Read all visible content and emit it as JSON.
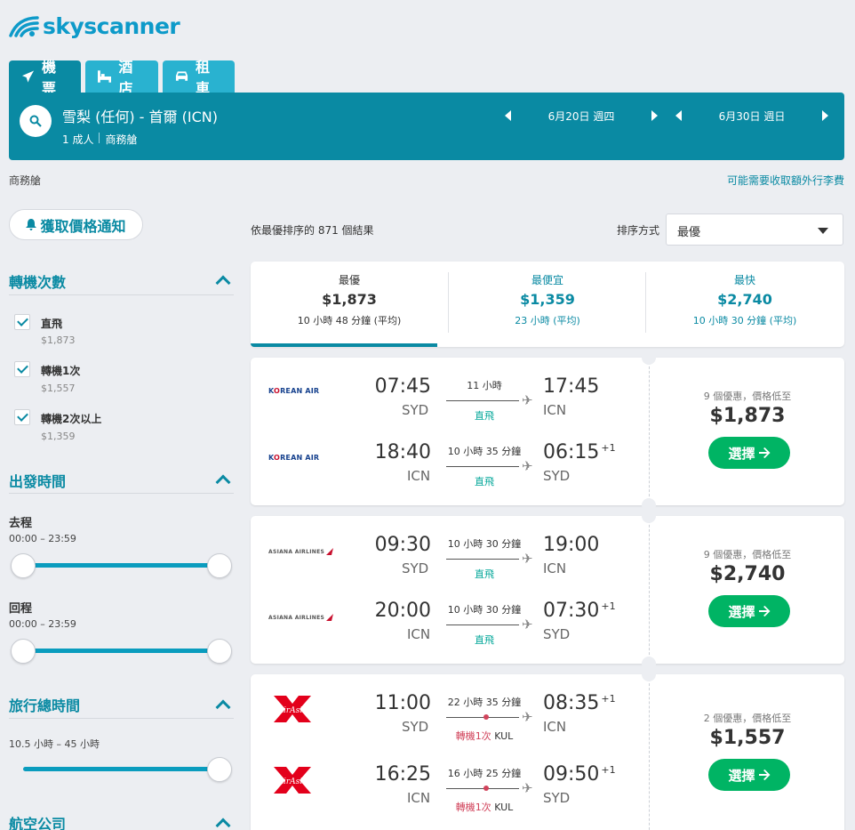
{
  "brand": {
    "name": "skyscanner",
    "color": "#0d9ac9",
    "accent": "#0a8aa3",
    "cta": "#00b464"
  },
  "tabs": [
    {
      "label": "機票",
      "icon": "plane-icon",
      "active": true
    },
    {
      "label": "酒店",
      "icon": "bed-icon",
      "active": false
    },
    {
      "label": "租車",
      "icon": "car-icon",
      "active": false
    }
  ],
  "search": {
    "route": "雪梨 (任何) - 首爾 (ICN)",
    "passengers": "1 成人",
    "cabin": "商務艙",
    "depart_date": "6月20日 週四",
    "return_date": "6月30日 週日"
  },
  "cabin_note": "商務艙",
  "baggage_note": "可能需要收取額外行李費",
  "alert_label": "獲取價格通知",
  "filters": {
    "stops": {
      "title": "轉機次數",
      "items": [
        {
          "label": "直飛",
          "price": "$1,873",
          "checked": true
        },
        {
          "label": "轉機1次",
          "price": "$1,557",
          "checked": true
        },
        {
          "label": "轉機2次以上",
          "price": "$1,359",
          "checked": true
        }
      ]
    },
    "times": {
      "title": "出發時間",
      "outbound_label": "去程",
      "outbound_range": "00:00 – 23:59",
      "return_label": "回程",
      "return_range": "00:00 – 23:59"
    },
    "duration": {
      "title": "旅行總時間",
      "range": "10.5 小時 – 45 小時"
    },
    "airlines": {
      "title": "航空公司"
    }
  },
  "results": {
    "count_text": "依最優排序的 871 個結果",
    "sort_label": "排序方式",
    "sort_value": "最優"
  },
  "summary": [
    {
      "title": "最優",
      "price": "$1,873",
      "duration": "10 小時 48 分鐘 (平均)",
      "active": true
    },
    {
      "title": "最便宜",
      "price": "$1,359",
      "duration": "23 小時 (平均)",
      "active": false
    },
    {
      "title": "最快",
      "price": "$2,740",
      "duration": "10 小時 30 分鐘 (平均)",
      "active": false
    }
  ],
  "cards": [
    {
      "airline": "KOREAN AIR",
      "logo": "korean-air-logo",
      "legs": [
        {
          "dep": "07:45",
          "from": "SYD",
          "dur": "11 小時",
          "stops": "直飛",
          "arr": "17:45",
          "to": "ICN",
          "plus": ""
        },
        {
          "dep": "18:40",
          "from": "ICN",
          "dur": "10 小時 35 分鐘",
          "stops": "直飛",
          "arr": "06:15",
          "to": "SYD",
          "plus": "+1"
        }
      ],
      "deals": "9 個優惠，價格低至",
      "price": "$1,873",
      "cta": "選擇"
    },
    {
      "airline": "ASIANA AIRLINES",
      "logo": "asiana-airlines-logo",
      "legs": [
        {
          "dep": "09:30",
          "from": "SYD",
          "dur": "10 小時 30 分鐘",
          "stops": "直飛",
          "arr": "19:00",
          "to": "ICN",
          "plus": ""
        },
        {
          "dep": "20:00",
          "from": "ICN",
          "dur": "10 小時 30 分鐘",
          "stops": "直飛",
          "arr": "07:30",
          "to": "SYD",
          "plus": "+1"
        }
      ],
      "deals": "9 個優惠，價格低至",
      "price": "$2,740",
      "cta": "選擇"
    },
    {
      "airline": "AirAsia",
      "logo": "airasia-logo",
      "legs": [
        {
          "dep": "11:00",
          "from": "SYD",
          "dur": "22 小時 35 分鐘",
          "stops_pre": "轉機",
          "stops_num": "1次",
          "stops_via": "KUL",
          "arr": "08:35",
          "to": "ICN",
          "plus": "+1"
        },
        {
          "dep": "16:25",
          "from": "ICN",
          "dur": "16 小時 25 分鐘",
          "stops_pre": "轉機",
          "stops_num": "1次",
          "stops_via": "KUL",
          "arr": "09:50",
          "to": "SYD",
          "plus": "+1"
        }
      ],
      "deals": "2 個優惠，價格低至",
      "price": "$1,557",
      "cta": "選擇"
    }
  ]
}
